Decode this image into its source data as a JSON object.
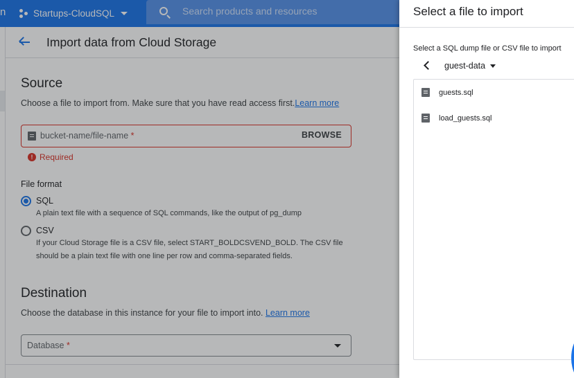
{
  "topbar": {
    "left_fragment": "n",
    "project_name": "Startups-CloudSQL",
    "search_placeholder": "Search products and resources"
  },
  "page": {
    "title": "Import data from Cloud Storage",
    "source": {
      "heading": "Source",
      "description": "Choose a file to import from. Make sure that you have read access first.",
      "learn_more": "Learn more",
      "file_input_placeholder": "bucket-name/file-name",
      "required_marker": "*",
      "browse_label": "BROWSE",
      "error_text": "Required"
    },
    "file_format": {
      "label": "File format",
      "options": [
        {
          "label": "SQL",
          "selected": true,
          "description": "A plain text file with a sequence of SQL commands, like the output of pg_dump"
        },
        {
          "label": "CSV",
          "selected": false,
          "description_line1": "If your Cloud Storage file is a CSV file, select START_BOLDCSVEND_BOLD. The CSV file",
          "description_line2": "should be a plain text file with one line per row and comma-separated fields."
        }
      ]
    },
    "destination": {
      "heading": "Destination",
      "description": "Choose the database in this instance for your file to import into.",
      "learn_more": "Learn more",
      "database_placeholder": "Database",
      "required_marker": "*"
    }
  },
  "drawer": {
    "title": "Select a file to import",
    "hint": "Select a SQL dump file or CSV file to import",
    "bucket": "guest-data",
    "files": [
      "guests.sql",
      "load_guests.sql"
    ]
  },
  "colors": {
    "brand_blue": "#1a73e8",
    "error_red": "#d93025"
  },
  "icons": [
    "search-icon",
    "back-arrow-icon",
    "file-icon",
    "error-icon",
    "chevron-left-icon",
    "dropdown-caret-icon"
  ]
}
